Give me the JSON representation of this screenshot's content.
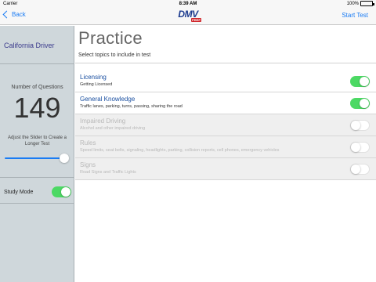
{
  "status": {
    "carrier": "Carrier",
    "time": "8:39 AM",
    "battery": "100%",
    "battery_level": 1.0
  },
  "nav": {
    "back_label": "Back",
    "logo_text": "DMV",
    "logo_badge": "PREP",
    "start_label": "Start Test"
  },
  "sidebar": {
    "title": "California Driver",
    "questions_label": "Number of Questions",
    "questions_value": "149",
    "slider_hint": "Adjust the Slider to Create a Longer Test",
    "slider_value": 1.0,
    "study_mode_label": "Study Mode",
    "study_mode_on": true
  },
  "main": {
    "title": "Practice",
    "subtitle": "Select topics to include in test",
    "topics": [
      {
        "title": "Licensing",
        "desc": "Getting Licensed",
        "on": true,
        "enabled": true
      },
      {
        "title": "General Knowledge",
        "desc": "Traffic lanes, parking, turns, passing, sharing the road",
        "on": true,
        "enabled": true
      },
      {
        "title": "Impaired Driving",
        "desc": "Alcohol and other impaired driving",
        "on": false,
        "enabled": false
      },
      {
        "title": "Rules",
        "desc": "Speed limits, seat belts, signaling, headlights, parking, collision reports, cell phones, emergency vehicles",
        "on": false,
        "enabled": false
      },
      {
        "title": "Signs",
        "desc": "Road Signs and Traffic Lights",
        "on": false,
        "enabled": false
      }
    ]
  },
  "colors": {
    "accent": "#1a7cf4",
    "toggle_on": "#4cd964",
    "sidebar_bg": "#cfd7db"
  }
}
